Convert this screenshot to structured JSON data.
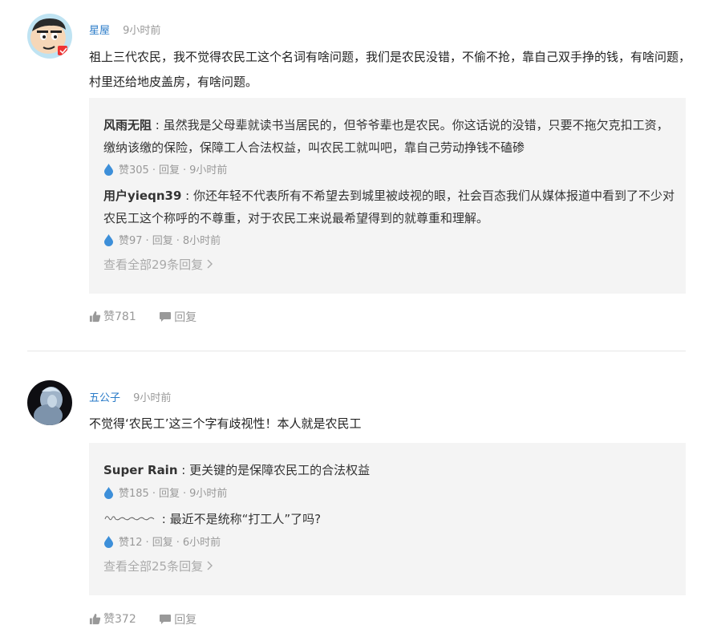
{
  "comments": [
    {
      "author": "星屋",
      "time": "9小时前",
      "text": "祖上三代农民，我不觉得农民工这个名词有啥问题，我们是农民没错，不偷不抢，靠自己双手挣的钱，有啥问题，村里还给地皮盖房，有啥问题。",
      "replies": [
        {
          "name": "风雨无阻",
          "text": "虽然我是父母辈就读书当居民的，但爷爷辈也是农民。你这话说的没错，只要不拖欠克扣工资，缴纳该缴的保险，保障工人合法权益，叫农民工就叫吧，靠自己劳动挣钱不磕碜",
          "likes": "赞305",
          "reply_label": "回复",
          "time": "9小时前"
        },
        {
          "name": "用户yieqn39",
          "text": "你还年轻不代表所有不希望去到城里被歧视的眼，社会百态我们从媒体报道中看到了不少对农民工这个称呼的不尊重，对于农民工来说最希望得到的就尊重和理解。",
          "likes": "赞97",
          "reply_label": "回复",
          "time": "8小时前"
        }
      ],
      "view_all": "查看全部29条回复",
      "like_count": "赞781",
      "reply_label": "回复"
    },
    {
      "author": "五公子",
      "time": "9小时前",
      "text": "不觉得‘农民工’这三个字有歧视性！本人就是农民工",
      "replies": [
        {
          "name": "Super Rain",
          "text": "更关键的是保障农民工的合法权益",
          "likes": "赞185",
          "reply_label": "回复",
          "time": "9小时前"
        },
        {
          "name": "",
          "text": "最近不是统称“打工人”了吗?",
          "likes": "赞12",
          "reply_label": "回复",
          "time": "6小时前"
        }
      ],
      "view_all": "查看全部25条回复",
      "like_count": "赞372",
      "reply_label": "回复"
    }
  ],
  "colors": {
    "author": "#2a7bc8",
    "reply_bg": "#f4f4f4",
    "drop": "#3d8fd9"
  },
  "icons": [
    "water-drop-icon",
    "thumbs-up-icon",
    "speech-bubble-icon",
    "chevron-right-icon"
  ]
}
